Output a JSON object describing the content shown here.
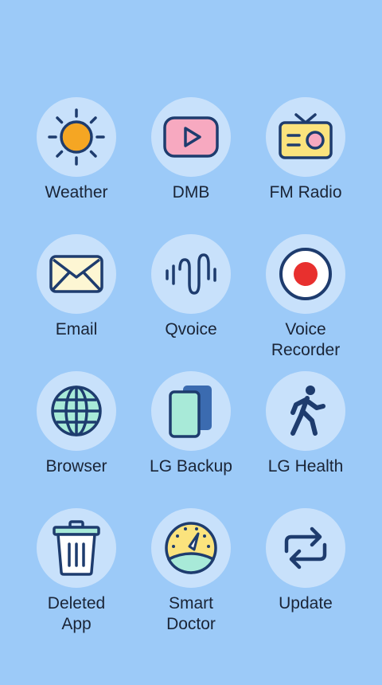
{
  "apps": [
    {
      "label": "Weather",
      "icon": "weather-sun-icon"
    },
    {
      "label": "DMB",
      "icon": "play-tv-icon"
    },
    {
      "label": "FM Radio",
      "icon": "radio-icon"
    },
    {
      "label": "Email",
      "icon": "envelope-icon"
    },
    {
      "label": "Qvoice",
      "icon": "sound-wave-icon"
    },
    {
      "label": "Voice\nRecorder",
      "icon": "record-button-icon"
    },
    {
      "label": "Browser",
      "icon": "globe-icon"
    },
    {
      "label": "LG Backup",
      "icon": "backup-cards-icon"
    },
    {
      "label": "LG Health",
      "icon": "walking-person-icon"
    },
    {
      "label": "Deleted\nApp",
      "icon": "trash-bin-icon"
    },
    {
      "label": "Smart\nDoctor",
      "icon": "speed-gauge-icon"
    },
    {
      "label": "Update",
      "icon": "refresh-arrows-icon"
    }
  ],
  "colors": {
    "background": "#9ccaf8",
    "circle": "#c8e1fb",
    "stroke": "#1e3c6e",
    "label_text": "#1a2436",
    "sun": "#f5a623",
    "record_red": "#e8302e"
  }
}
